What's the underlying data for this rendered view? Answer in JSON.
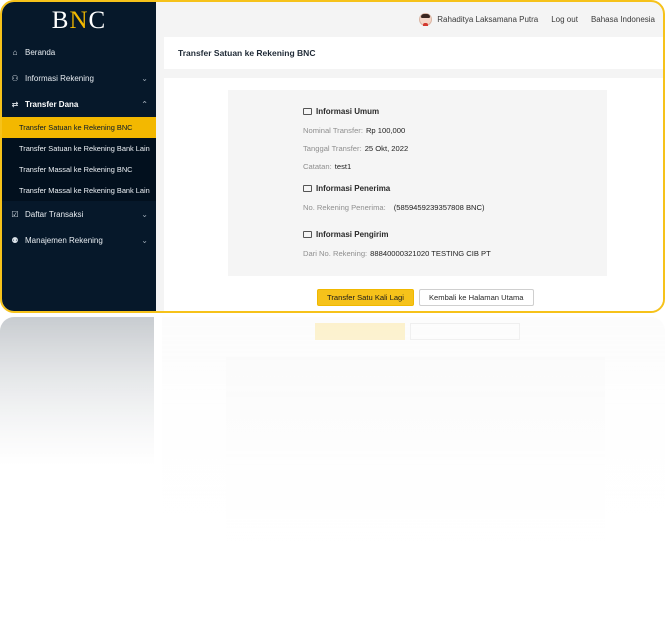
{
  "brand": {
    "logo_left": "B",
    "logo_mid": "N",
    "logo_right": "C"
  },
  "sidebar": {
    "items": [
      {
        "label": "Beranda",
        "icon": "home-icon"
      },
      {
        "label": "Informasi Rekening",
        "icon": "user-icon"
      },
      {
        "label": "Transfer Dana",
        "icon": "transfer-icon"
      },
      {
        "label": "Daftar Transaksi",
        "icon": "list-icon"
      },
      {
        "label": "Manajemen Rekening",
        "icon": "users-icon"
      }
    ],
    "transfer_sub": [
      "Transfer Satuan ke Rekening BNC",
      "Transfer Satuan ke Rekening Bank Lain",
      "Transfer Massal ke Rekening BNC",
      "Transfer Massal ke Rekening Bank Lain"
    ]
  },
  "topbar": {
    "user_name": "Rahaditya Laksamana Putra",
    "logout": "Log out",
    "language": "Bahasa Indonesia"
  },
  "page": {
    "title": "Transfer Satuan ke Rekening BNC"
  },
  "summary": {
    "general": {
      "title": "Informasi Umum",
      "amount_label": "Nominal Transfer",
      "amount_value": "Rp 100,000",
      "date_label": "Tanggal Transfer",
      "date_value": "25 Okt, 2022",
      "note_label": "Catatan",
      "note_value": "test1"
    },
    "recipient": {
      "title": "Informasi Penerima",
      "account_label": "No. Rekening Penerima",
      "account_value": "(5859459239357808 BNC)"
    },
    "sender": {
      "title": "Informasi Pengirim",
      "account_label": "Dari No. Rekening",
      "account_value": "88840000321020 TESTING CIB PT"
    }
  },
  "actions": {
    "transfer_again": "Transfer Satu Kali Lagi",
    "back_home": "Kembali ke Halaman Utama"
  },
  "colors": {
    "accent": "#f6c21a",
    "sidebar_bg": "#06182a"
  }
}
